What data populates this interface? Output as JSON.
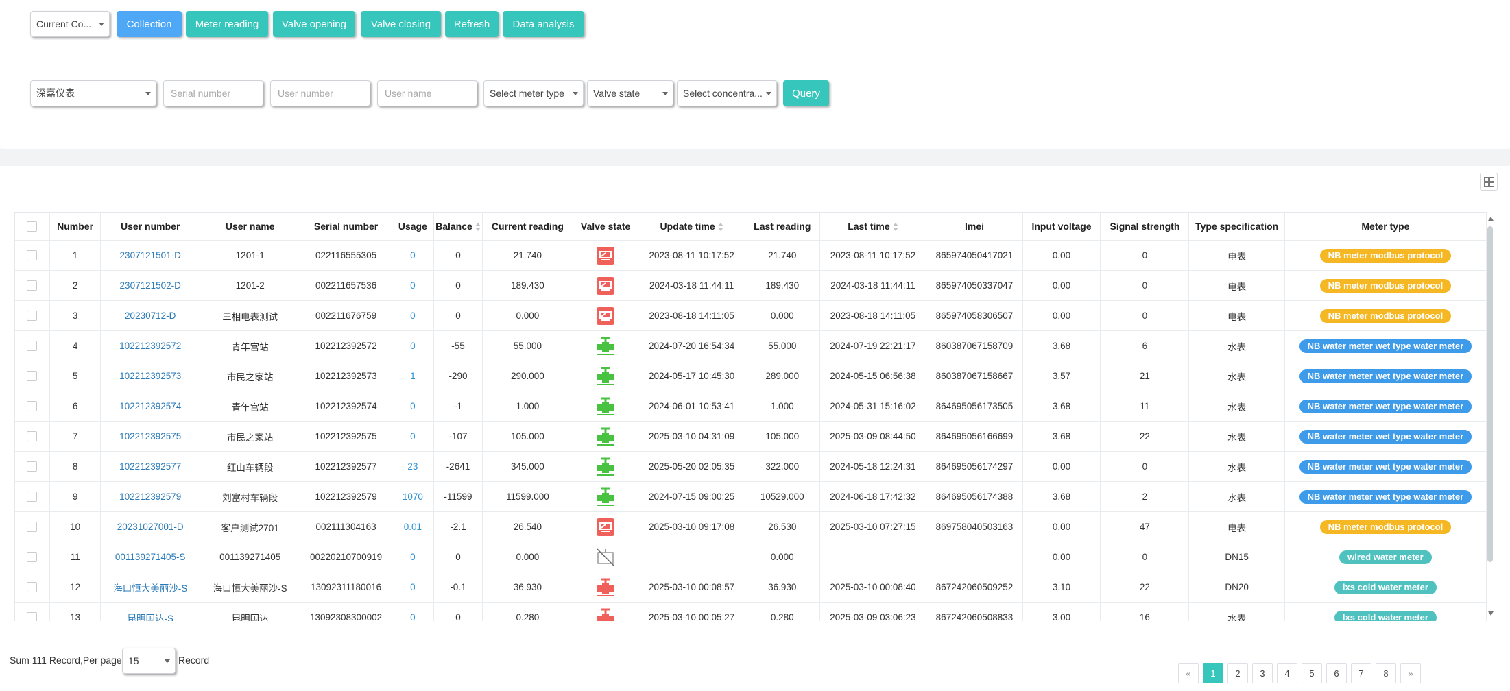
{
  "toolbar": {
    "type_select": "Current Co...",
    "buttons": [
      {
        "label": "Collection",
        "style": "blue"
      },
      {
        "label": "Meter reading",
        "style": "teal"
      },
      {
        "label": "Valve opening",
        "style": "teal"
      },
      {
        "label": "Valve closing",
        "style": "teal"
      },
      {
        "label": "Refresh",
        "style": "teal"
      },
      {
        "label": "Data analysis",
        "style": "teal"
      }
    ]
  },
  "filters": {
    "company_select": "深嘉仪表",
    "serial_placeholder": "Serial number",
    "user_number_placeholder": "User number",
    "user_name_placeholder": "User name",
    "meter_type_select": "Select meter type",
    "valve_state_select": "Valve state",
    "concentrator_select": "Select concentra...",
    "query_label": "Query"
  },
  "table": {
    "columns": [
      "",
      "Number",
      "User number",
      "User name",
      "Serial number",
      "Usage",
      "Balance",
      "Current reading",
      "Valve state",
      "Update time",
      "Last reading",
      "Last time",
      "Imei",
      "Input voltage",
      "Signal strength",
      "Type specification",
      "Meter type"
    ],
    "sortable_columns": [
      "Balance",
      "Update time",
      "Last time"
    ],
    "rows": [
      {
        "number": "1",
        "user_number": "2307121501-D",
        "user_name": "1201-1",
        "serial": "022116555305",
        "usage": "0",
        "balance": "0",
        "current": "21.740",
        "valve": "closed-red",
        "update": "2023-08-11 10:17:52",
        "last_reading": "21.740",
        "last_time": "2023-08-11 10:17:52",
        "imei": "865974050417021",
        "voltage": "0.00",
        "signal": "0",
        "type_spec": "电表",
        "meter_type": "NB meter modbus protocol",
        "badge": "orange"
      },
      {
        "number": "2",
        "user_number": "2307121502-D",
        "user_name": "1201-2",
        "serial": "002211657536",
        "usage": "0",
        "balance": "0",
        "current": "189.430",
        "valve": "closed-red",
        "update": "2024-03-18 11:44:11",
        "last_reading": "189.430",
        "last_time": "2024-03-18 11:44:11",
        "imei": "865974050337047",
        "voltage": "0.00",
        "signal": "0",
        "type_spec": "电表",
        "meter_type": "NB meter modbus protocol",
        "badge": "orange"
      },
      {
        "number": "3",
        "user_number": "20230712-D",
        "user_name": "三相电表测试",
        "serial": "002211676759",
        "usage": "0",
        "balance": "0",
        "current": "0.000",
        "valve": "closed-red",
        "update": "2023-08-18 14:11:05",
        "last_reading": "0.000",
        "last_time": "2023-08-18 14:11:05",
        "imei": "865974058306507",
        "voltage": "0.00",
        "signal": "0",
        "type_spec": "电表",
        "meter_type": "NB meter modbus protocol",
        "badge": "orange"
      },
      {
        "number": "4",
        "user_number": "102212392572",
        "user_name": "青年宫站",
        "serial": "102212392572",
        "usage": "0",
        "balance": "-55",
        "current": "55.000",
        "valve": "open-green",
        "update": "2024-07-20 16:54:34",
        "last_reading": "55.000",
        "last_time": "2024-07-19 22:21:17",
        "imei": "860387067158709",
        "voltage": "3.68",
        "signal": "6",
        "type_spec": "水表",
        "meter_type": "NB water meter wet type water meter",
        "badge": "blue"
      },
      {
        "number": "5",
        "user_number": "102212392573",
        "user_name": "市民之家站",
        "serial": "102212392573",
        "usage": "1",
        "balance": "-290",
        "current": "290.000",
        "valve": "open-green",
        "update": "2024-05-17 10:45:30",
        "last_reading": "289.000",
        "last_time": "2024-05-15 06:56:38",
        "imei": "860387067158667",
        "voltage": "3.57",
        "signal": "21",
        "type_spec": "水表",
        "meter_type": "NB water meter wet type water meter",
        "badge": "blue"
      },
      {
        "number": "6",
        "user_number": "102212392574",
        "user_name": "青年宫站",
        "serial": "102212392574",
        "usage": "0",
        "balance": "-1",
        "current": "1.000",
        "valve": "open-green",
        "update": "2024-06-01 10:53:41",
        "last_reading": "1.000",
        "last_time": "2024-05-31 15:16:02",
        "imei": "864695056173505",
        "voltage": "3.68",
        "signal": "11",
        "type_spec": "水表",
        "meter_type": "NB water meter wet type water meter",
        "badge": "blue"
      },
      {
        "number": "7",
        "user_number": "102212392575",
        "user_name": "市民之家站",
        "serial": "102212392575",
        "usage": "0",
        "balance": "-107",
        "current": "105.000",
        "valve": "open-green",
        "update": "2025-03-10 04:31:09",
        "last_reading": "105.000",
        "last_time": "2025-03-09 08:44:50",
        "imei": "864695056166699",
        "voltage": "3.68",
        "signal": "22",
        "type_spec": "水表",
        "meter_type": "NB water meter wet type water meter",
        "badge": "blue"
      },
      {
        "number": "8",
        "user_number": "102212392577",
        "user_name": "红山车辆段",
        "serial": "102212392577",
        "usage": "23",
        "balance": "-2641",
        "current": "345.000",
        "valve": "open-green",
        "update": "2025-05-20 02:05:35",
        "last_reading": "322.000",
        "last_time": "2024-05-18 12:24:31",
        "imei": "864695056174297",
        "voltage": "0.00",
        "signal": "0",
        "type_spec": "水表",
        "meter_type": "NB water meter wet type water meter",
        "badge": "blue"
      },
      {
        "number": "9",
        "user_number": "102212392579",
        "user_name": "刘富村车辆段",
        "serial": "102212392579",
        "usage": "1070",
        "balance": "-11599",
        "current": "11599.000",
        "valve": "open-green",
        "update": "2024-07-15 09:00:25",
        "last_reading": "10529.000",
        "last_time": "2024-06-18 17:42:32",
        "imei": "864695056174388",
        "voltage": "3.68",
        "signal": "2",
        "type_spec": "水表",
        "meter_type": "NB water meter wet type water meter",
        "badge": "blue"
      },
      {
        "number": "10",
        "user_number": "20231027001-D",
        "user_name": "客户测试2701",
        "serial": "002111304163",
        "usage": "0.01",
        "balance": "-2.1",
        "current": "26.540",
        "valve": "closed-red",
        "update": "2025-03-10 09:17:08",
        "last_reading": "26.530",
        "last_time": "2025-03-10 07:27:15",
        "imei": "869758040503163",
        "voltage": "0.00",
        "signal": "47",
        "type_spec": "电表",
        "meter_type": "NB meter modbus protocol",
        "badge": "orange"
      },
      {
        "number": "11",
        "user_number": "001139271405-S",
        "user_name": "001139271405",
        "serial": "00220210700919",
        "usage": "0",
        "balance": "0",
        "current": "0.000",
        "valve": "none-gray",
        "update": "",
        "last_reading": "0.000",
        "last_time": "",
        "imei": "",
        "voltage": "0.00",
        "signal": "0",
        "type_spec": "DN15",
        "meter_type": "wired water meter",
        "badge": "teal"
      },
      {
        "number": "12",
        "user_number": "海口恒大美丽沙-S",
        "user_name": "海口恒大美丽沙-S",
        "serial": "13092311180016",
        "usage": "0",
        "balance": "-0.1",
        "current": "36.930",
        "valve": "closed-redvalve",
        "update": "2025-03-10 00:08:57",
        "last_reading": "36.930",
        "last_time": "2025-03-10 00:08:40",
        "imei": "867242060509252",
        "voltage": "3.10",
        "signal": "22",
        "type_spec": "DN20",
        "meter_type": "lxs cold water meter",
        "badge": "teal"
      },
      {
        "number": "13",
        "user_number": "昆明国达-S",
        "user_name": "昆明国达",
        "serial": "13092308300002",
        "usage": "0",
        "balance": "0",
        "current": "0.280",
        "valve": "closed-redvalve",
        "update": "2025-03-10 00:05:27",
        "last_reading": "0.280",
        "last_time": "2025-03-09 03:06:23",
        "imei": "867242060508833",
        "voltage": "3.00",
        "signal": "16",
        "type_spec": "水表",
        "meter_type": "lxs cold water meter",
        "badge": "teal"
      }
    ]
  },
  "footer": {
    "sum_text": "Sum 111 Record,Per page",
    "per_page": "15",
    "record_text": "Record",
    "pages": [
      "«",
      "1",
      "2",
      "3",
      "4",
      "5",
      "6",
      "7",
      "8",
      "»"
    ],
    "active_page": "1"
  },
  "colors": {
    "blue_button": "#4fa8f5",
    "teal_button": "#36c6bb",
    "badge_orange": "#f5b824",
    "badge_blue": "#3d9be9",
    "badge_teal": "#4fc2c0",
    "valve_red": "#f0605a",
    "valve_green": "#49c141"
  }
}
